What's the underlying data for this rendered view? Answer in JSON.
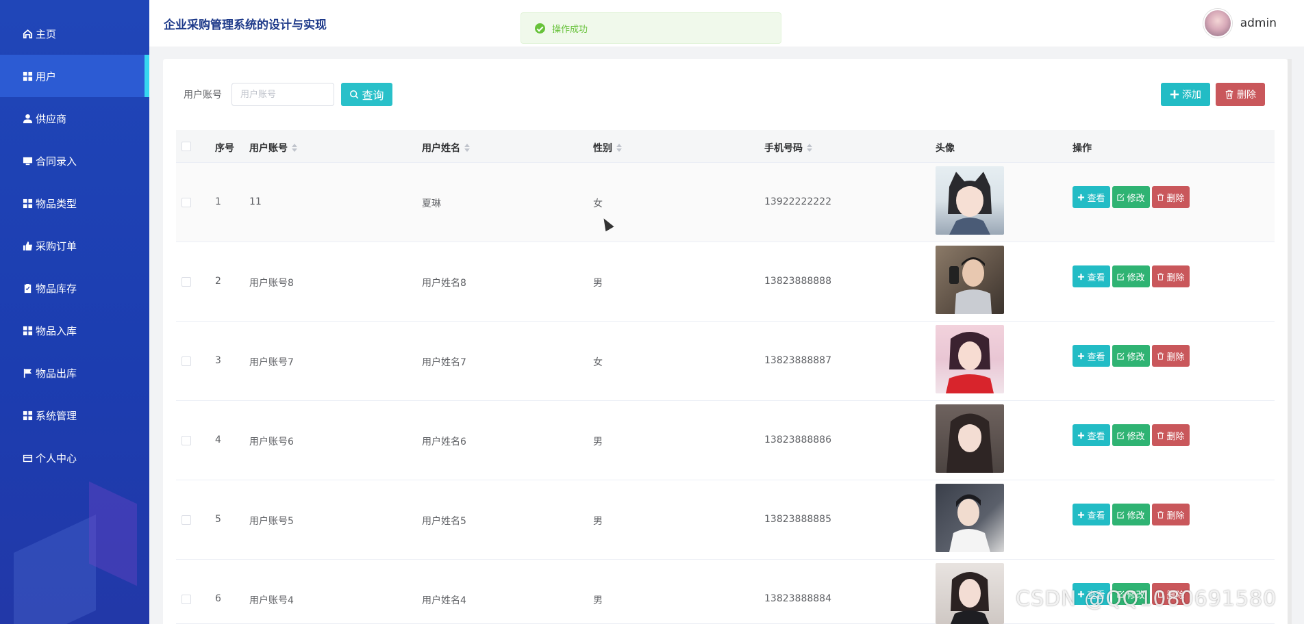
{
  "sidebar": {
    "items": [
      {
        "label": "主页",
        "icon": "home-icon"
      },
      {
        "label": "用户",
        "icon": "grid-icon",
        "active": true
      },
      {
        "label": "供应商",
        "icon": "user-icon"
      },
      {
        "label": "合同录入",
        "icon": "monitor-icon"
      },
      {
        "label": "物品类型",
        "icon": "grid-icon"
      },
      {
        "label": "采购订单",
        "icon": "thumb-icon"
      },
      {
        "label": "物品库存",
        "icon": "clipboard-icon"
      },
      {
        "label": "物品入库",
        "icon": "grid-icon"
      },
      {
        "label": "物品出库",
        "icon": "flag-icon"
      },
      {
        "label": "系统管理",
        "icon": "grid-icon"
      },
      {
        "label": "个人中心",
        "icon": "card-icon"
      }
    ]
  },
  "header": {
    "title": "企业采购管理系统的设计与实现",
    "toast": "操作成功",
    "username": "admin"
  },
  "search": {
    "label": "用户账号",
    "placeholder": "用户账号",
    "value": "",
    "query_label": "查询"
  },
  "toolbar": {
    "add_label": "添加",
    "delete_label": "删除"
  },
  "table": {
    "headers": {
      "index": "序号",
      "account": "用户账号",
      "name": "用户姓名",
      "gender": "性别",
      "phone": "手机号码",
      "avatar": "头像",
      "actions": "操作"
    },
    "action_labels": {
      "view": "查看",
      "edit": "修改",
      "remove": "删除"
    },
    "rows": [
      {
        "index": "1",
        "account": "11",
        "name": "夏琳",
        "gender": "女",
        "phone": "13922222222"
      },
      {
        "index": "2",
        "account": "用户账号8",
        "name": "用户姓名8",
        "gender": "男",
        "phone": "13823888888"
      },
      {
        "index": "3",
        "account": "用户账号7",
        "name": "用户姓名7",
        "gender": "女",
        "phone": "13823888887"
      },
      {
        "index": "4",
        "account": "用户账号6",
        "name": "用户姓名6",
        "gender": "男",
        "phone": "13823888886"
      },
      {
        "index": "5",
        "account": "用户账号5",
        "name": "用户姓名5",
        "gender": "男",
        "phone": "13823888885"
      },
      {
        "index": "6",
        "account": "用户账号4",
        "name": "用户姓名4",
        "gender": "男",
        "phone": "13823888884"
      }
    ]
  },
  "watermark": "CSDN @QQ1080691580",
  "colors": {
    "sidebar": "#1f43b5",
    "sidebar_active": "#2c5bd3",
    "accent_cyan": "#22bcc5",
    "success": "#2fb373",
    "danger": "#c9575b",
    "title": "#1e3a8a"
  }
}
